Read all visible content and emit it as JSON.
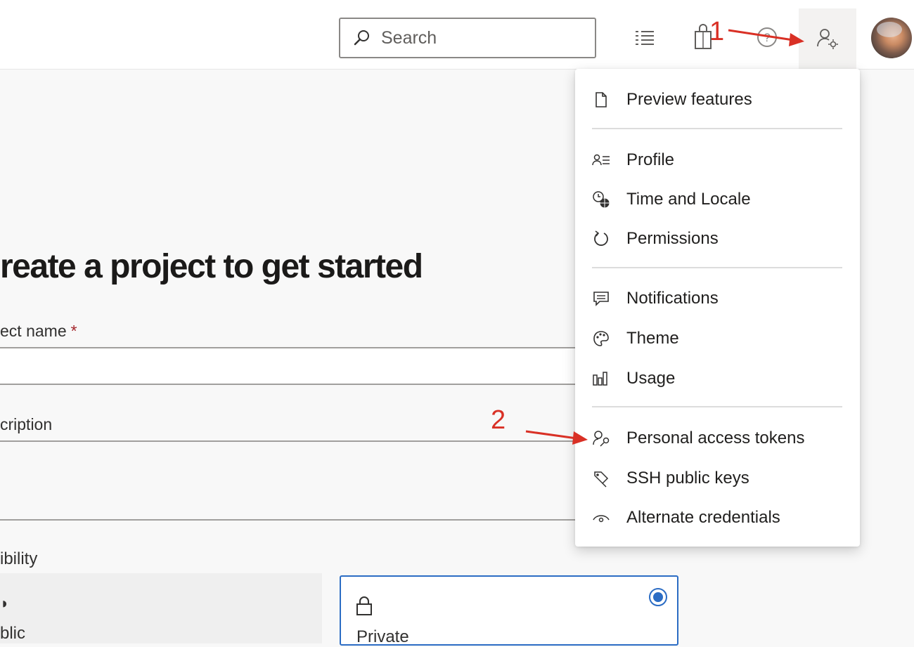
{
  "header": {
    "search_placeholder": "Search",
    "icons": [
      "search-icon",
      "task-list-icon",
      "marketplace-bag-icon",
      "help-icon",
      "user-settings-icon"
    ]
  },
  "page": {
    "title": "reate a project to get started",
    "project_name_label": "ect name",
    "required_mark": "*",
    "description_label": "cription",
    "visibility_label": "ibility",
    "public_card": {
      "icon_fragment": "◗",
      "label": "blic"
    },
    "private_card": {
      "label": "Private",
      "selected": true
    }
  },
  "menu": {
    "items": [
      {
        "label": "Preview features",
        "icon": "page-icon"
      },
      {
        "label": "Profile",
        "icon": "profile-card-icon"
      },
      {
        "label": "Time and Locale",
        "icon": "clock-globe-icon"
      },
      {
        "label": "Permissions",
        "icon": "refresh-icon"
      },
      {
        "label": "Notifications",
        "icon": "chat-bubble-icon"
      },
      {
        "label": "Theme",
        "icon": "palette-icon"
      },
      {
        "label": "Usage",
        "icon": "bar-chart-icon"
      },
      {
        "label": "Personal access tokens",
        "icon": "user-key-icon"
      },
      {
        "label": "SSH public keys",
        "icon": "key-icon"
      },
      {
        "label": "Alternate credentials",
        "icon": "eye-icon"
      }
    ]
  },
  "annotations": {
    "step1": "1",
    "step2": "2",
    "color": "#d93025"
  },
  "colors": {
    "accent": "#2b6cc4",
    "required": "#a4262c"
  }
}
